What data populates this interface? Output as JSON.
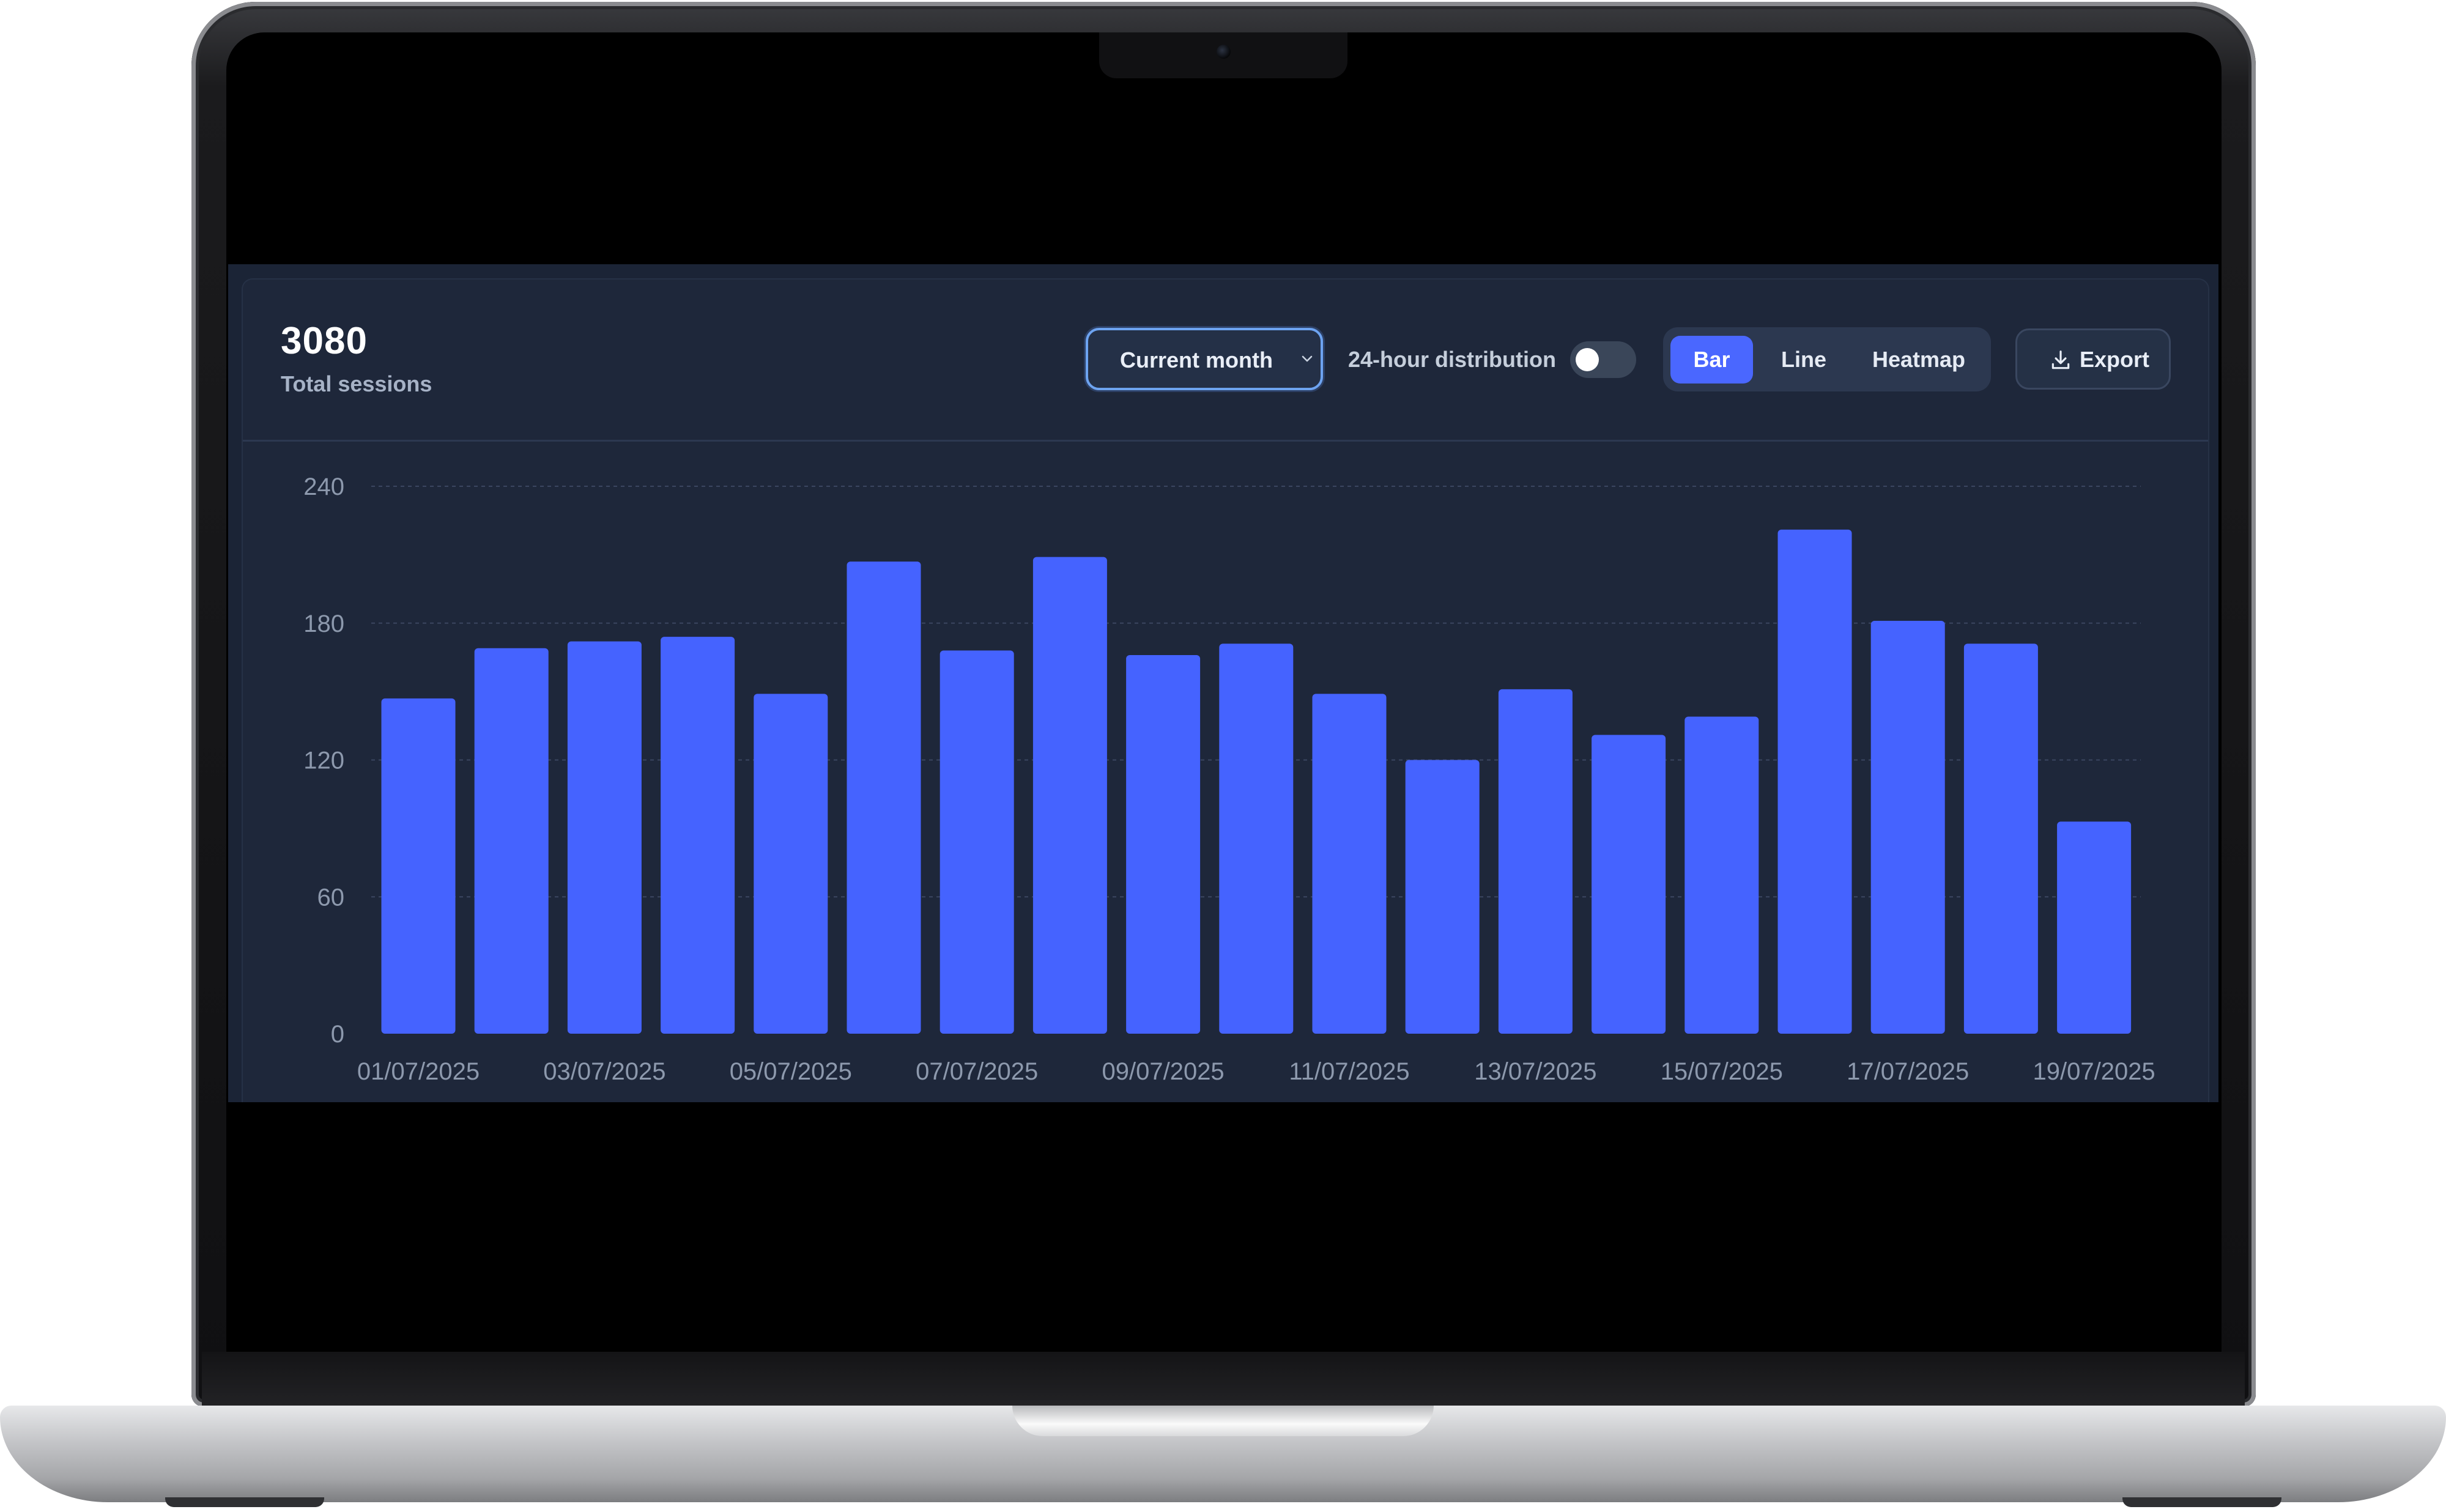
{
  "summary": {
    "total_value": "3080",
    "total_label": "Total sessions"
  },
  "controls": {
    "period_select": {
      "value": "Current month"
    },
    "distribution_toggle": {
      "label": "24-hour distribution",
      "on": false
    },
    "chart_type_options": [
      "Bar",
      "Line",
      "Heatmap"
    ],
    "chart_type_selected": "Bar",
    "export_label": "Export"
  },
  "colors": {
    "accent": "#4a67ff",
    "bar": "#4563ff",
    "card_bg": "#1e273a",
    "grid": "#3b4660",
    "axis_text": "#8d99ad"
  },
  "icons": {
    "period_select_chevron": "chevron-down-icon",
    "export": "download-icon"
  },
  "chart_data": {
    "type": "bar",
    "categories": [
      "01/07/2025",
      "02/07/2025",
      "03/07/2025",
      "04/07/2025",
      "05/07/2025",
      "06/07/2025",
      "07/07/2025",
      "08/07/2025",
      "09/07/2025",
      "10/07/2025",
      "11/07/2025",
      "12/07/2025",
      "13/07/2025",
      "14/07/2025",
      "15/07/2025",
      "16/07/2025",
      "17/07/2025",
      "18/07/2025",
      "19/07/2025"
    ],
    "tick_labels": [
      "01/07/2025",
      "03/07/2025",
      "05/07/2025",
      "07/07/2025",
      "09/07/2025",
      "11/07/2025",
      "13/07/2025",
      "15/07/2025",
      "17/07/2025",
      "19/07/2025"
    ],
    "values": [
      147,
      169,
      172,
      174,
      149,
      207,
      168,
      209,
      166,
      171,
      149,
      120,
      151,
      131,
      139,
      221,
      181,
      171,
      93
    ],
    "yticks": [
      0,
      60,
      120,
      180,
      240
    ],
    "ylim": [
      0,
      240
    ],
    "grid": true,
    "legend": "none"
  }
}
